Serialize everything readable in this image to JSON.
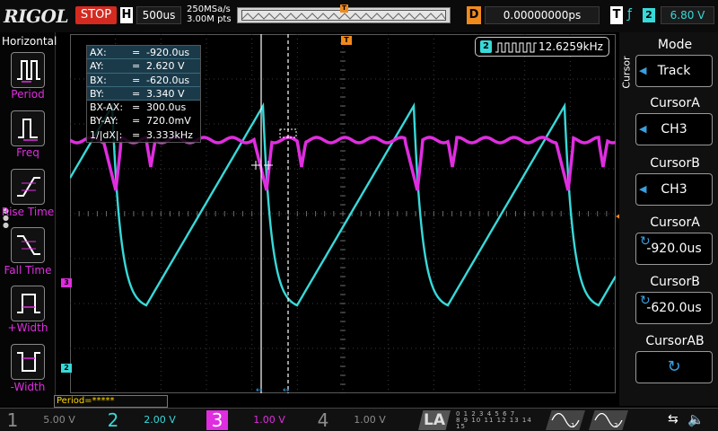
{
  "topbar": {
    "brand": "RIGOL",
    "run_status": "STOP",
    "timebase_label": "H",
    "timebase": "500us",
    "sample_rate": "250MSa/s",
    "mem_depth": "3.00M pts",
    "trigger_pos_marker": "T",
    "delay_label": "D",
    "delay": "0.00000000ps",
    "trigger_label": "T",
    "trigger_slope": "ƒ",
    "trigger_source": "2",
    "trigger_level": "6.80 V"
  },
  "left_menu": {
    "title": "Horizontal",
    "items": [
      {
        "label": "Period",
        "icon": "period-icon"
      },
      {
        "label": "Freq",
        "icon": "freq-icon"
      },
      {
        "label": "Rise Time",
        "icon": "rise-time-icon"
      },
      {
        "label": "Fall Time",
        "icon": "fall-time-icon"
      },
      {
        "label": "+Width",
        "icon": "positive-width-icon"
      },
      {
        "label": "-Width",
        "icon": "negative-width-icon"
      }
    ]
  },
  "cursor_readout": {
    "rows": [
      {
        "name": "AX:",
        "eq": "=",
        "value": "-920.0us"
      },
      {
        "name": "AY:",
        "eq": "=",
        "value": "2.620 V"
      },
      {
        "name": "BX:",
        "eq": "=",
        "value": "-620.0us"
      },
      {
        "name": "BY:",
        "eq": "=",
        "value": "3.340 V"
      },
      {
        "name": "BX-AX:",
        "eq": "=",
        "value": "300.0us"
      },
      {
        "name": "BY-AY:",
        "eq": "=",
        "value": "720.0mV"
      },
      {
        "name": "1/|dX|:",
        "eq": "=",
        "value": "3.333kHz"
      }
    ]
  },
  "frequency_counter": {
    "channel": "2",
    "value": "12.6259kHz"
  },
  "channel_markers": {
    "ch3": "3",
    "ch2": "2",
    "trigger": "T"
  },
  "measure_bar": "Period=*****",
  "right_menu": {
    "side_label": "Cursor",
    "sections": [
      {
        "title": "Mode",
        "value": "Track"
      },
      {
        "title": "CursorA",
        "value": "CH3"
      },
      {
        "title": "CursorB",
        "value": "CH3"
      },
      {
        "title": "CursorA",
        "value": "-920.0us"
      },
      {
        "title": "CursorB",
        "value": "-620.0us"
      },
      {
        "title": "CursorAB",
        "value": ""
      }
    ]
  },
  "channels": [
    {
      "num": "1",
      "scale": "5.00 V",
      "color": "#8c8c8c"
    },
    {
      "num": "2",
      "scale": "2.00 V",
      "color": "#38d9d9"
    },
    {
      "num": "3",
      "scale": "1.00 V",
      "color": "#e02de0"
    },
    {
      "num": "4",
      "scale": "1.00 V",
      "color": "#8c8c8c"
    }
  ],
  "la_label": "LA",
  "la_digits": [
    "0 1 2 3   4 5 6 7",
    "8 9 10 11 12 13 14 15"
  ],
  "colors": {
    "ch2": "#38d9d9",
    "ch3": "#e02de0",
    "trigger": "#f08a1c",
    "stop": "#d42a1f"
  }
}
